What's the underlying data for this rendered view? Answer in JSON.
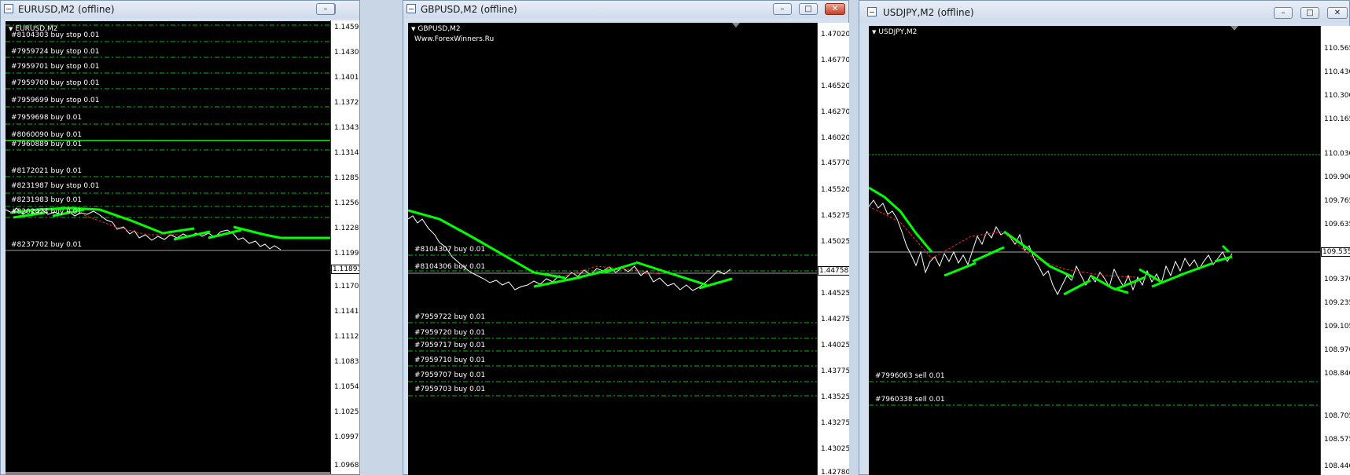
{
  "windows": {
    "eurusd": {
      "title": "EURUSD,M2 (offline)",
      "symbol": "EURUSD,M2",
      "orders": [
        "#8104303 buy stop 0.01",
        "#7959724 buy stop 0.01",
        "#7959701 buy stop 0.01",
        "#7959700 buy stop 0.01",
        "#7959699 buy stop 0.01",
        "#7959698 buy 0.01",
        "#8060090 buy 0.01",
        "#7960889 buy 0.01",
        "#8172021 buy 0.01",
        "#8231987 buy stop 0.01",
        "#8231983 buy 0.01",
        "#8202424 buy 0.01",
        "#8237702 buy 0.01"
      ],
      "prices": [
        "1.14590",
        "1.14300",
        "1.14010",
        "1.13720",
        "1.13435",
        "1.13145",
        "1.12855",
        "1.12565",
        "1.12280",
        "1.11990",
        "1.11700",
        "1.11410",
        "1.11125",
        "1.10835",
        "1.10545",
        "1.10255",
        "1.09970",
        "1.09680"
      ],
      "current_price": "1.11893"
    },
    "gbpusd": {
      "title": "GBPUSD,M2 (offline)",
      "symbol": "GBPUSD,M2",
      "watermark": "Www.ForexWinners.Ru",
      "orders": [
        "#8104307 buy 0.01",
        "#8104306 buy 0.01",
        "#7959722 buy 0.01",
        "#7959720 buy 0.01",
        "#7959717 buy 0.01",
        "#7959710 buy 0.01",
        "#7959707 buy 0.01",
        "#7959703 buy 0.01"
      ],
      "prices": [
        "1.47020",
        "1.46770",
        "1.46520",
        "1.46270",
        "1.46020",
        "1.45770",
        "1.45520",
        "1.45275",
        "1.45025",
        "1.44525",
        "1.44275",
        "1.44025",
        "1.43775",
        "1.43525",
        "1.43275",
        "1.43025",
        "1.42780"
      ],
      "current_price": "1.44758"
    },
    "usdjpy": {
      "title": "USDJPY,M2 (offline)",
      "symbol": "USDJPY,M2",
      "orders": [
        "#7996063 sell 0.01",
        "#7960338 sell 0.01"
      ],
      "prices": [
        "110.565",
        "110.430",
        "110.300",
        "110.165",
        "110.030",
        "109.900",
        "109.765",
        "109.635",
        "109.370",
        "109.235",
        "109.105",
        "108.970",
        "108.840",
        "108.705",
        "108.575",
        "108.440"
      ],
      "current_price": "109.535"
    }
  },
  "buttons": {
    "minimize": "–",
    "maximize": "□",
    "close": "✕"
  },
  "colors": {
    "chart_bg": "#000000",
    "price_line": "#ffffff",
    "indicator": "#00ff00",
    "order_line": "#00c000"
  }
}
